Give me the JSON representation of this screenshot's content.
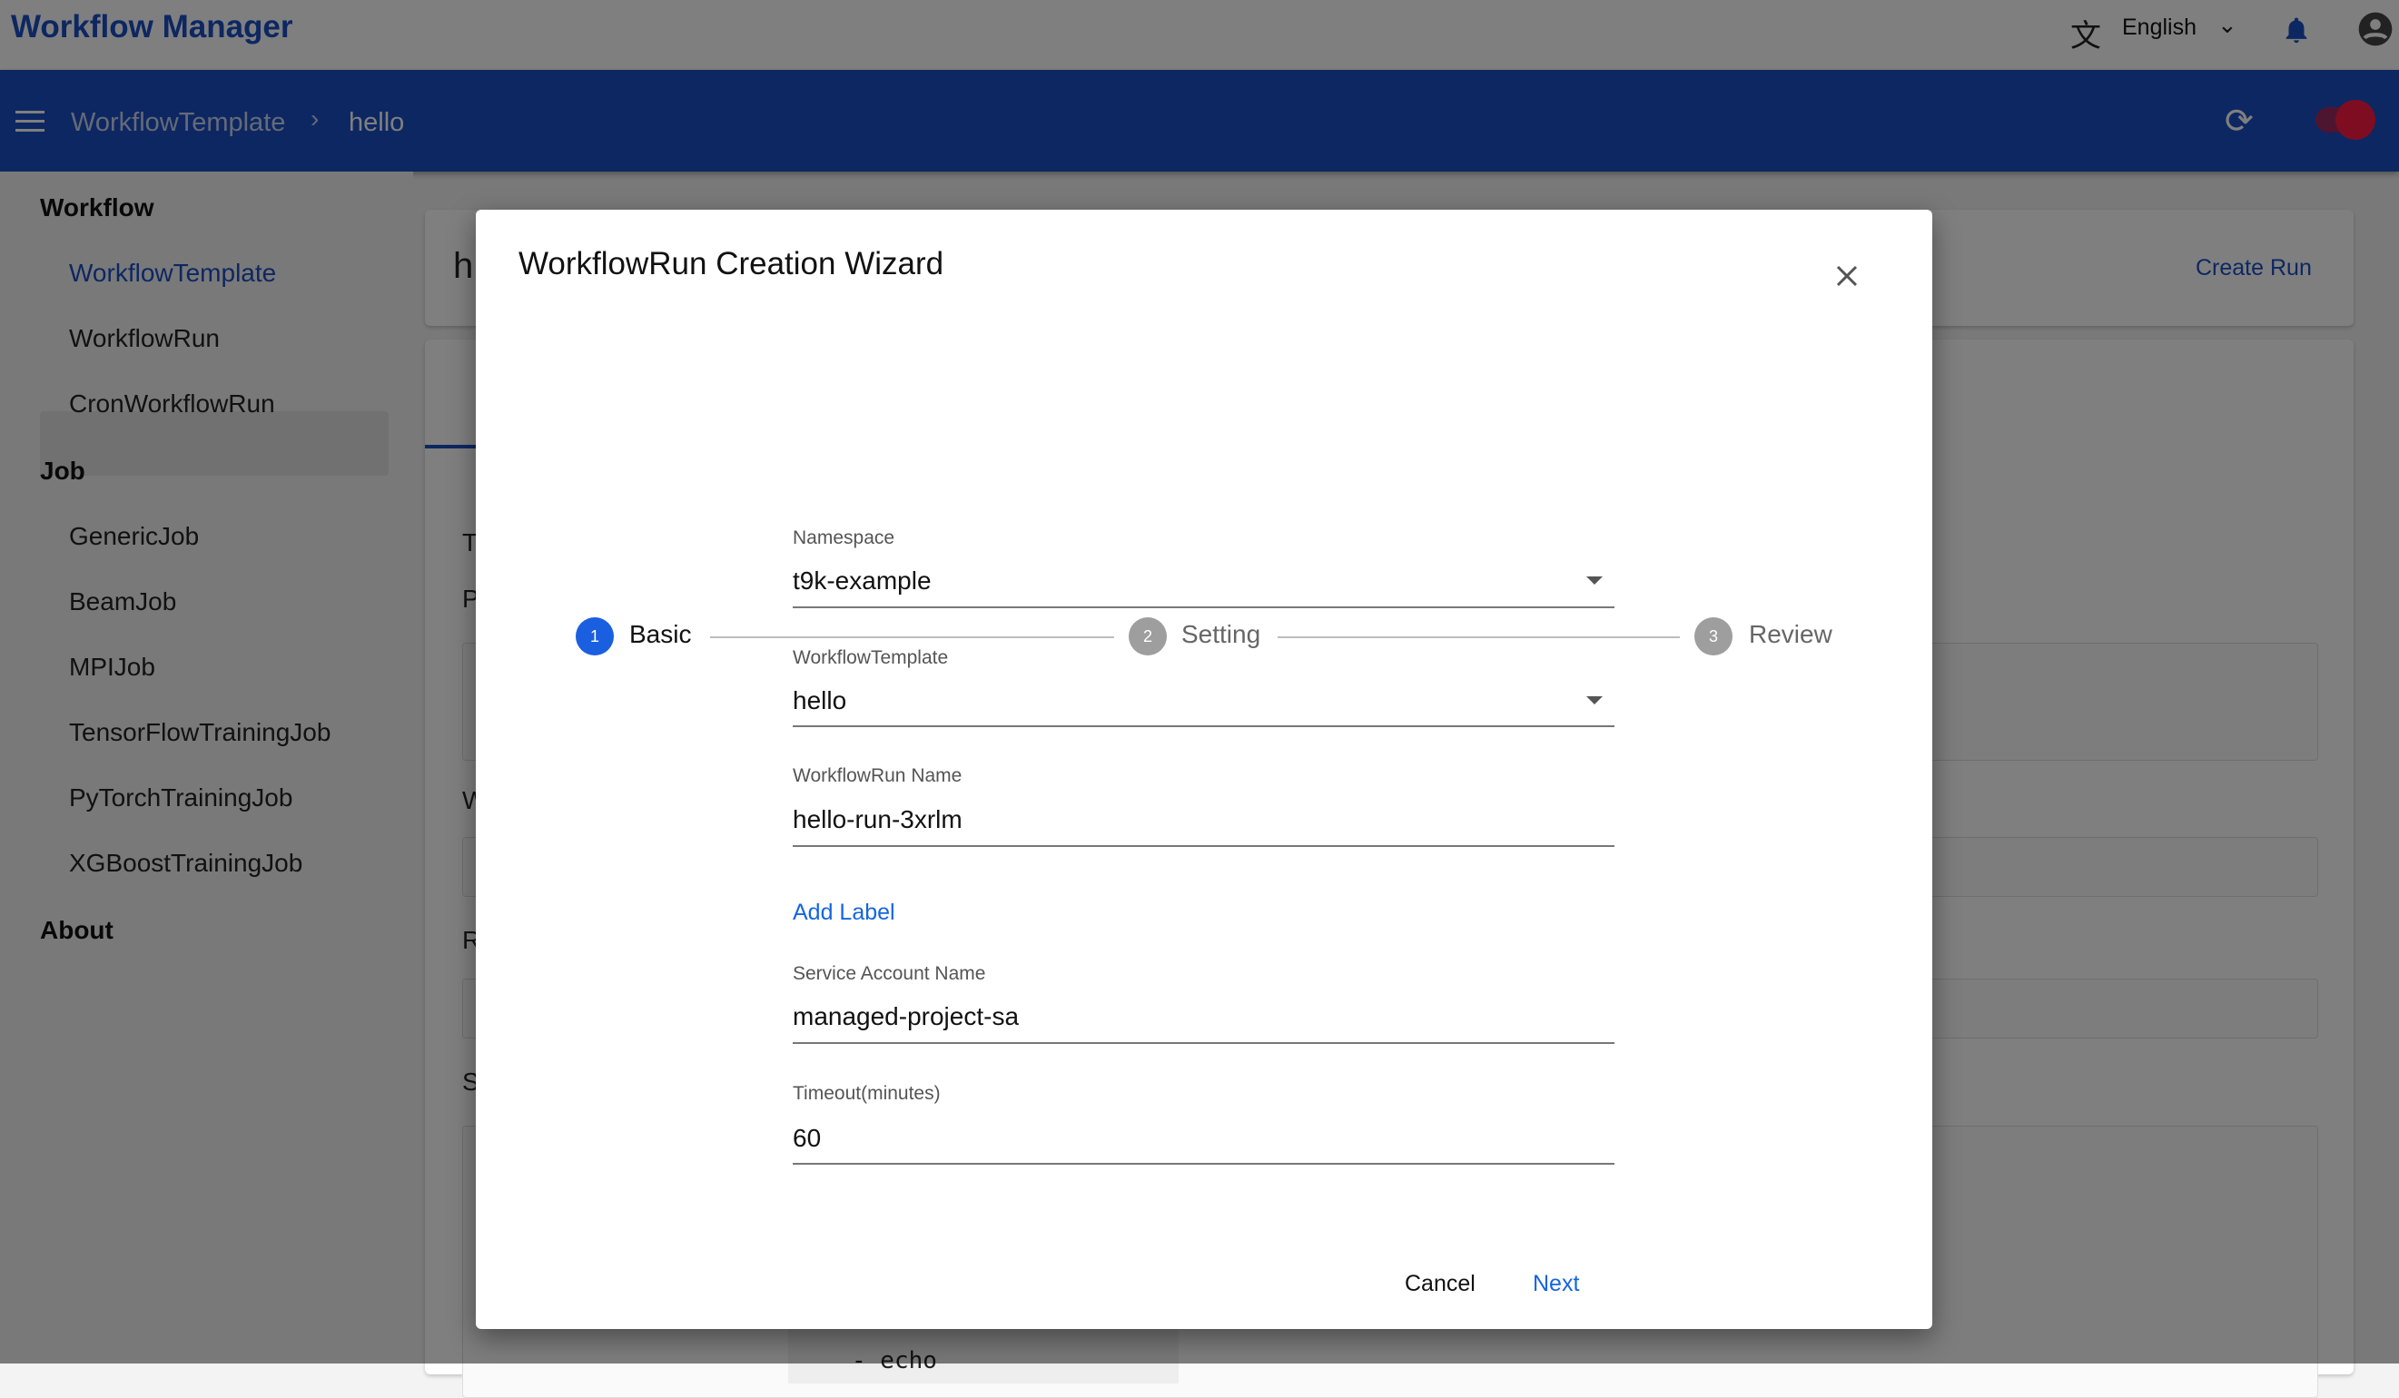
{
  "header": {
    "app_title": "Workflow Manager",
    "language": "English",
    "language_icon": "translate-icon",
    "notification_icon": "bell-icon",
    "account_icon": "account-circle-icon"
  },
  "appbar": {
    "breadcrumb": [
      "WorkflowTemplate",
      "hello"
    ],
    "refresh_icon": "refresh-icon",
    "toggle_color": "#e0103a"
  },
  "sidebar": {
    "sections": [
      {
        "title": "Workflow",
        "items": [
          "WorkflowTemplate",
          "WorkflowRun",
          "CronWorkflowRun"
        ]
      },
      {
        "title": "Job",
        "items": [
          "GenericJob",
          "BeamJob",
          "MPIJob",
          "TensorFlowTrainingJob",
          "PyTorchTrainingJob",
          "XGBoostTrainingJob"
        ]
      },
      {
        "title": "About",
        "items": []
      }
    ],
    "selected": "WorkflowTemplate"
  },
  "background": {
    "page_initial": "h",
    "create_run": "Create Run",
    "section_initials": [
      "T",
      "P",
      "W",
      "R",
      "S"
    ],
    "code_line": "- echo"
  },
  "dialog": {
    "title": "WorkflowRun Creation Wizard",
    "steps": [
      {
        "num": "1",
        "label": "Basic",
        "active": true
      },
      {
        "num": "2",
        "label": "Setting",
        "active": false
      },
      {
        "num": "3",
        "label": "Review",
        "active": false
      }
    ],
    "fields": {
      "namespace": {
        "label": "Namespace",
        "value": "t9k-example"
      },
      "template": {
        "label": "WorkflowTemplate",
        "value": "hello"
      },
      "run_name": {
        "label": "WorkflowRun Name",
        "value": "hello-run-3xrlm"
      },
      "service_account": {
        "label": "Service Account Name",
        "value": "managed-project-sa"
      },
      "timeout": {
        "label": "Timeout(minutes)",
        "value": "60"
      }
    },
    "add_label": "Add Label",
    "cancel": "Cancel",
    "next": "Next"
  },
  "colors": {
    "primary": "#1a4fc4",
    "link": "#1565e0",
    "step_active": "#1a5fe0",
    "step_inactive": "#9e9e9e"
  }
}
